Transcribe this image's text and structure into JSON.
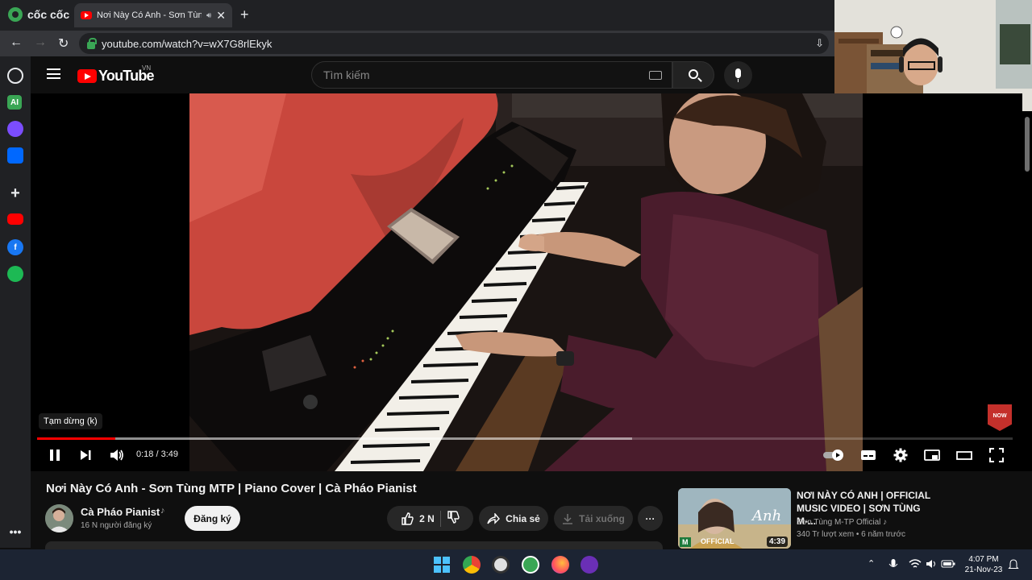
{
  "browser": {
    "brand": "cốc cốc",
    "tab_title": "Nơi Này Có Anh - Sơn Tùng",
    "url": "youtube.com/watch?v=wX7G8rlEkyk"
  },
  "youtube": {
    "logo_text": "YouTube",
    "region": "VN",
    "search_placeholder": "Tìm kiếm"
  },
  "player": {
    "tooltip": "Tạm dừng (k)",
    "current_time": "0:18",
    "duration": "3:49",
    "time_display": "0:18 / 3:49",
    "played_fraction": 0.08,
    "buffered_fraction": 0.61,
    "subscribe_badge": "NOW"
  },
  "video": {
    "title": "Nơi Này Có Anh - Sơn Tùng MTP | Piano Cover | Cà Pháo Pianist",
    "channel": "Cà Pháo Pianist",
    "subscribers": "16 N người đăng ký",
    "subscribe_label": "Đăng ký",
    "likes": "2 N",
    "share_label": "Chia sẻ",
    "download_label": "Tải xuống"
  },
  "suggested": {
    "title": "NƠI NÀY CÓ ANH | OFFICIAL MUSIC VIDEO | SƠN TÙNG M-...",
    "channel": "Sơn Tùng M-TP Official",
    "meta": "340 Tr lượt xem • 6 năm trước",
    "duration": "4:39",
    "badge": "M",
    "badge2": "OFFICIAL"
  },
  "taskbar": {
    "time": "4:07 PM",
    "date": "21-Nov-23"
  },
  "colors": {
    "accent": "#ff0000",
    "yt_bg": "#0f0f0f",
    "browser_bg": "#202124"
  }
}
